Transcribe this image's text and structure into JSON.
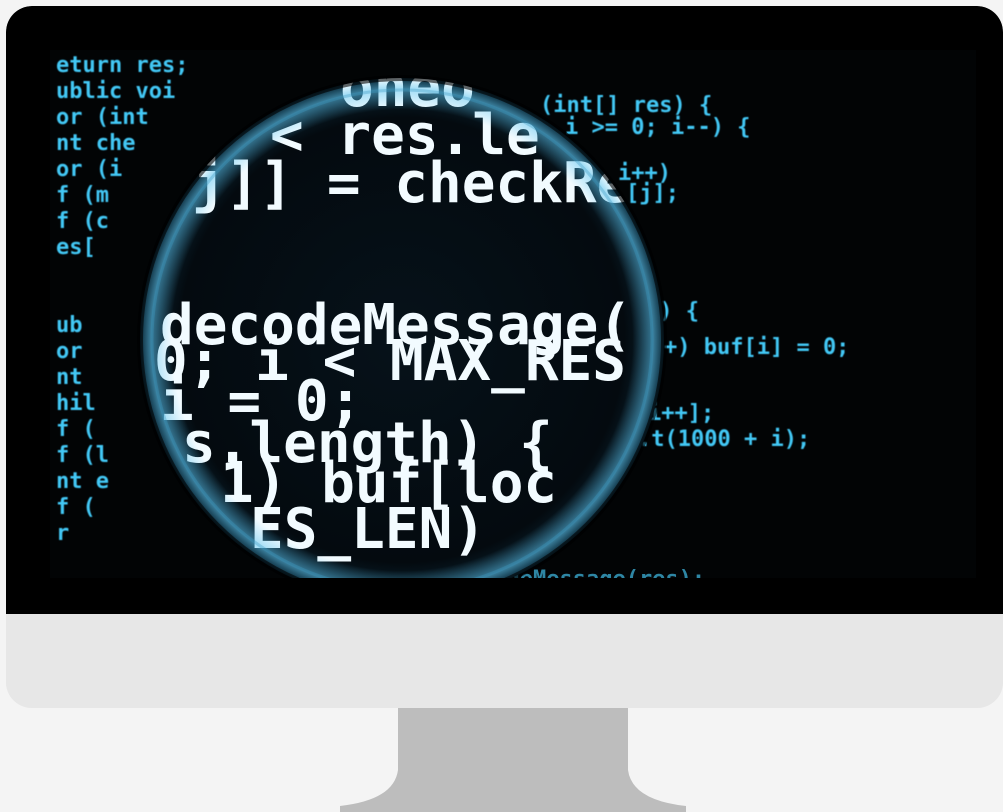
{
  "colors": {
    "background": "#f4f4f4",
    "monitor_body": "#e7e7e7",
    "bezel": "#000000",
    "screen": "#020405",
    "code_text": "#43c8f5",
    "magnified_text": "#ffffff",
    "lens_rim": "#66c6ee",
    "stand": "#bdbdbd"
  },
  "screen": {
    "left_code_lines": [
      "eturn res;",
      "ublic voi",
      "or (int",
      "nt che",
      "or (i",
      "f (m",
      "f (c",
      "es[",
      "",
      "",
      "ub",
      "or",
      "nt",
      "hil",
      "f (",
      "f (l",
      "nt e",
      "f (",
      "r"
    ],
    "right_code_lines": [
      "(int[] res) {",
      "i >= 0; i--) {",
      "i++)",
      "[j];",
      "s) {",
      "+) buf[i] = 0;",
      "i++];",
      ".t(1000 + i);"
    ],
    "magnified_lines": [
      "oneo",
      "< res.le",
      "j]] = checkRe",
      "decodeMessage(",
      "0; i < MAX_RES",
      "i = 0;",
      "s.length) {",
      "1) buf[loc",
      "ES_LEN)"
    ],
    "bottom_code_fragment": "codeMessage(res);"
  },
  "icons": {
    "lens": "magnifying-glass-icon",
    "monitor": "desktop-monitor-icon"
  }
}
